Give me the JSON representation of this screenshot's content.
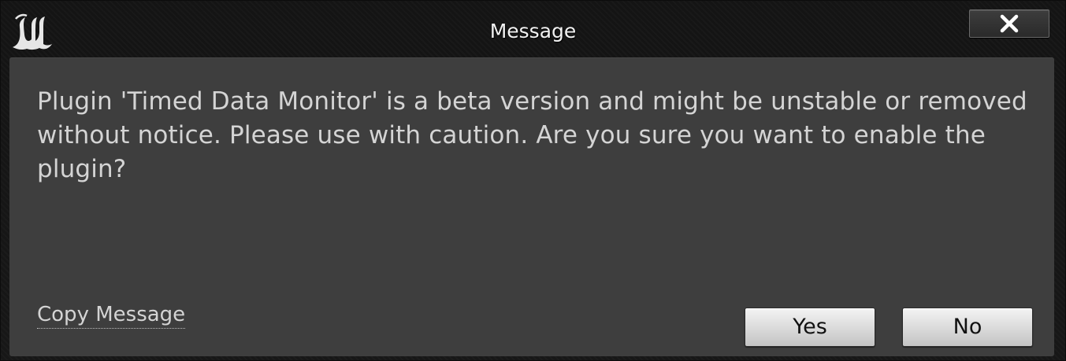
{
  "window": {
    "title": "Message",
    "logo": "unreal-engine-logo-icon",
    "close_icon": "close-icon"
  },
  "dialog": {
    "message": "Plugin 'Timed Data Monitor' is a beta version and might be unstable or removed without notice. Please use with caution. Are you sure you want to enable the plugin?",
    "copy_message_label": "Copy Message",
    "yes_label": "Yes",
    "no_label": "No"
  },
  "colors": {
    "panel_background": "#3e3e3e",
    "titlebar_background": "#161616",
    "text": "#d4d4d4",
    "button_face": "#dcdcdc"
  }
}
